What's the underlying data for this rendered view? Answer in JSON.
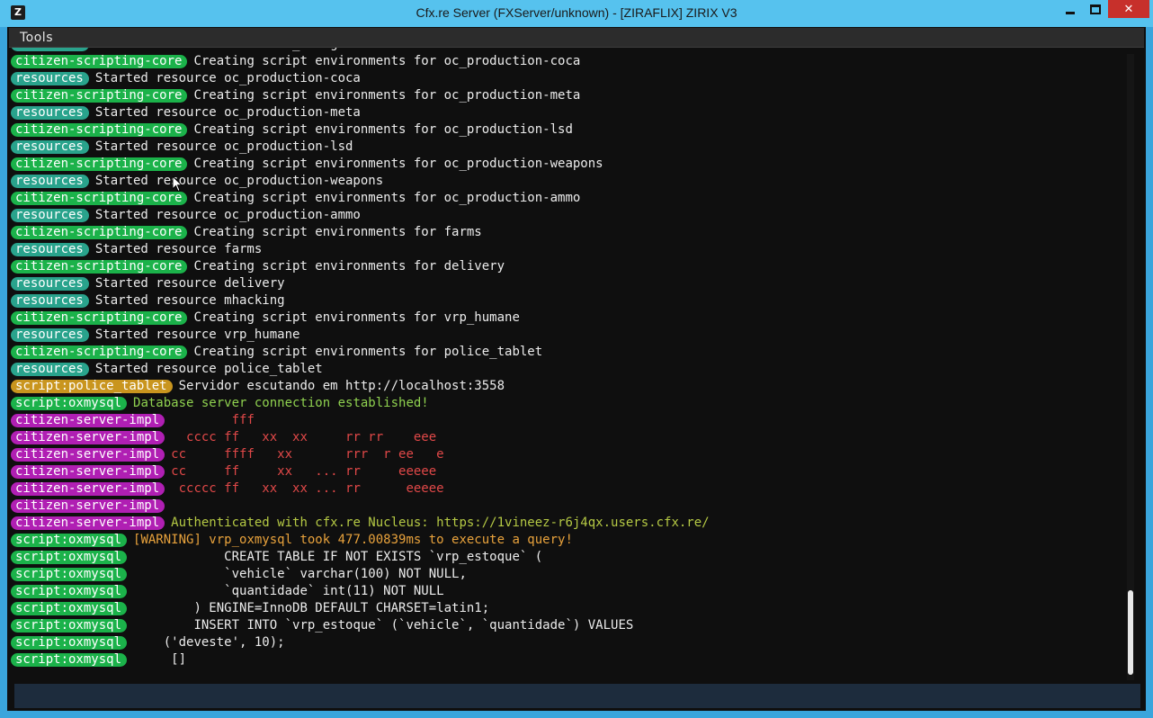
{
  "window": {
    "title": "Cfx.re Server (FXServer/unknown) - [ZIRAFLIX] ZIRIX V3",
    "app_icon": "Z",
    "close_glyph": "✕"
  },
  "menu": {
    "tools": "Tools"
  },
  "colors": {
    "resources": "#29a38c",
    "citizen-scripting-core": "#1bb24a",
    "script:police_tablet": "#c9951e",
    "script:oxmysql": "#1bb24a",
    "citizen-server-impl": "#b01fb3"
  },
  "console": {
    "lines": [
      {
        "tag": "resources",
        "text": "Started resource lscustoms_change",
        "color": "#ececec"
      },
      {
        "tag": "citizen-scripting-core",
        "text": "Creating script environments for oc_production-coca",
        "color": "#ececec"
      },
      {
        "tag": "resources",
        "text": "Started resource oc_production-coca",
        "color": "#ececec"
      },
      {
        "tag": "citizen-scripting-core",
        "text": "Creating script environments for oc_production-meta",
        "color": "#ececec"
      },
      {
        "tag": "resources",
        "text": "Started resource oc_production-meta",
        "color": "#ececec"
      },
      {
        "tag": "citizen-scripting-core",
        "text": "Creating script environments for oc_production-lsd",
        "color": "#ececec"
      },
      {
        "tag": "resources",
        "text": "Started resource oc_production-lsd",
        "color": "#ececec"
      },
      {
        "tag": "citizen-scripting-core",
        "text": "Creating script environments for oc_production-weapons",
        "color": "#ececec"
      },
      {
        "tag": "resources",
        "text": "Started resource oc_production-weapons",
        "color": "#ececec"
      },
      {
        "tag": "citizen-scripting-core",
        "text": "Creating script environments for oc_production-ammo",
        "color": "#ececec"
      },
      {
        "tag": "resources",
        "text": "Started resource oc_production-ammo",
        "color": "#ececec"
      },
      {
        "tag": "citizen-scripting-core",
        "text": "Creating script environments for farms",
        "color": "#ececec"
      },
      {
        "tag": "resources",
        "text": "Started resource farms",
        "color": "#ececec"
      },
      {
        "tag": "citizen-scripting-core",
        "text": "Creating script environments for delivery",
        "color": "#ececec"
      },
      {
        "tag": "resources",
        "text": "Started resource delivery",
        "color": "#ececec"
      },
      {
        "tag": "resources",
        "text": "Started resource mhacking",
        "color": "#ececec"
      },
      {
        "tag": "citizen-scripting-core",
        "text": "Creating script environments for vrp_humane",
        "color": "#ececec"
      },
      {
        "tag": "resources",
        "text": "Started resource vrp_humane",
        "color": "#ececec"
      },
      {
        "tag": "citizen-scripting-core",
        "text": "Creating script environments for police_tablet",
        "color": "#ececec"
      },
      {
        "tag": "resources",
        "text": "Started resource police_tablet",
        "color": "#ececec"
      },
      {
        "tag": "script:police_tablet",
        "text": "Servidor escutando em http://localhost:3558",
        "color": "#ececec"
      },
      {
        "tag": "script:oxmysql",
        "text": "Database server connection established!",
        "color": "#8fd14f"
      },
      {
        "tag": "citizen-server-impl",
        "text": "        fff",
        "color": "#e04848"
      },
      {
        "tag": "citizen-server-impl",
        "text": "  cccc ff   xx  xx     rr rr    eee",
        "color": "#e04848"
      },
      {
        "tag": "citizen-server-impl",
        "text": "cc     ffff   xx       rrr  r ee   e",
        "color": "#e04848"
      },
      {
        "tag": "citizen-server-impl",
        "text": "cc     ff     xx   ... rr     eeeee",
        "color": "#e04848"
      },
      {
        "tag": "citizen-server-impl",
        "text": " ccccc ff   xx  xx ... rr      eeeee",
        "color": "#e04848"
      },
      {
        "tag": "citizen-server-impl",
        "text": "",
        "color": "#e04848"
      },
      {
        "tag": "citizen-server-impl",
        "text": "Authenticated with cfx.re Nucleus: https://1vineez-r6j4qx.users.cfx.re/",
        "color": "#b5c944"
      },
      {
        "tag": "script:oxmysql",
        "text": "[WARNING] vrp_oxmysql took 477.00839ms to execute a query!",
        "color": "#e8a23c"
      },
      {
        "tag": "script:oxmysql",
        "text": "            CREATE TABLE IF NOT EXISTS `vrp_estoque` (",
        "color": "#ececec"
      },
      {
        "tag": "script:oxmysql",
        "text": "            `vehicle` varchar(100) NOT NULL,",
        "color": "#ececec"
      },
      {
        "tag": "script:oxmysql",
        "text": "            `quantidade` int(11) NOT NULL",
        "color": "#ececec"
      },
      {
        "tag": "script:oxmysql",
        "text": "        ) ENGINE=InnoDB DEFAULT CHARSET=latin1;",
        "color": "#ececec"
      },
      {
        "tag": "script:oxmysql",
        "text": "        INSERT INTO `vrp_estoque` (`vehicle`, `quantidade`) VALUES",
        "color": "#ececec"
      },
      {
        "tag": "script:oxmysql",
        "text": "    ('deveste', 10);",
        "color": "#ececec"
      },
      {
        "tag": "script:oxmysql",
        "text": "     []",
        "color": "#ececec"
      }
    ]
  },
  "input": {
    "value": "",
    "placeholder": ""
  }
}
